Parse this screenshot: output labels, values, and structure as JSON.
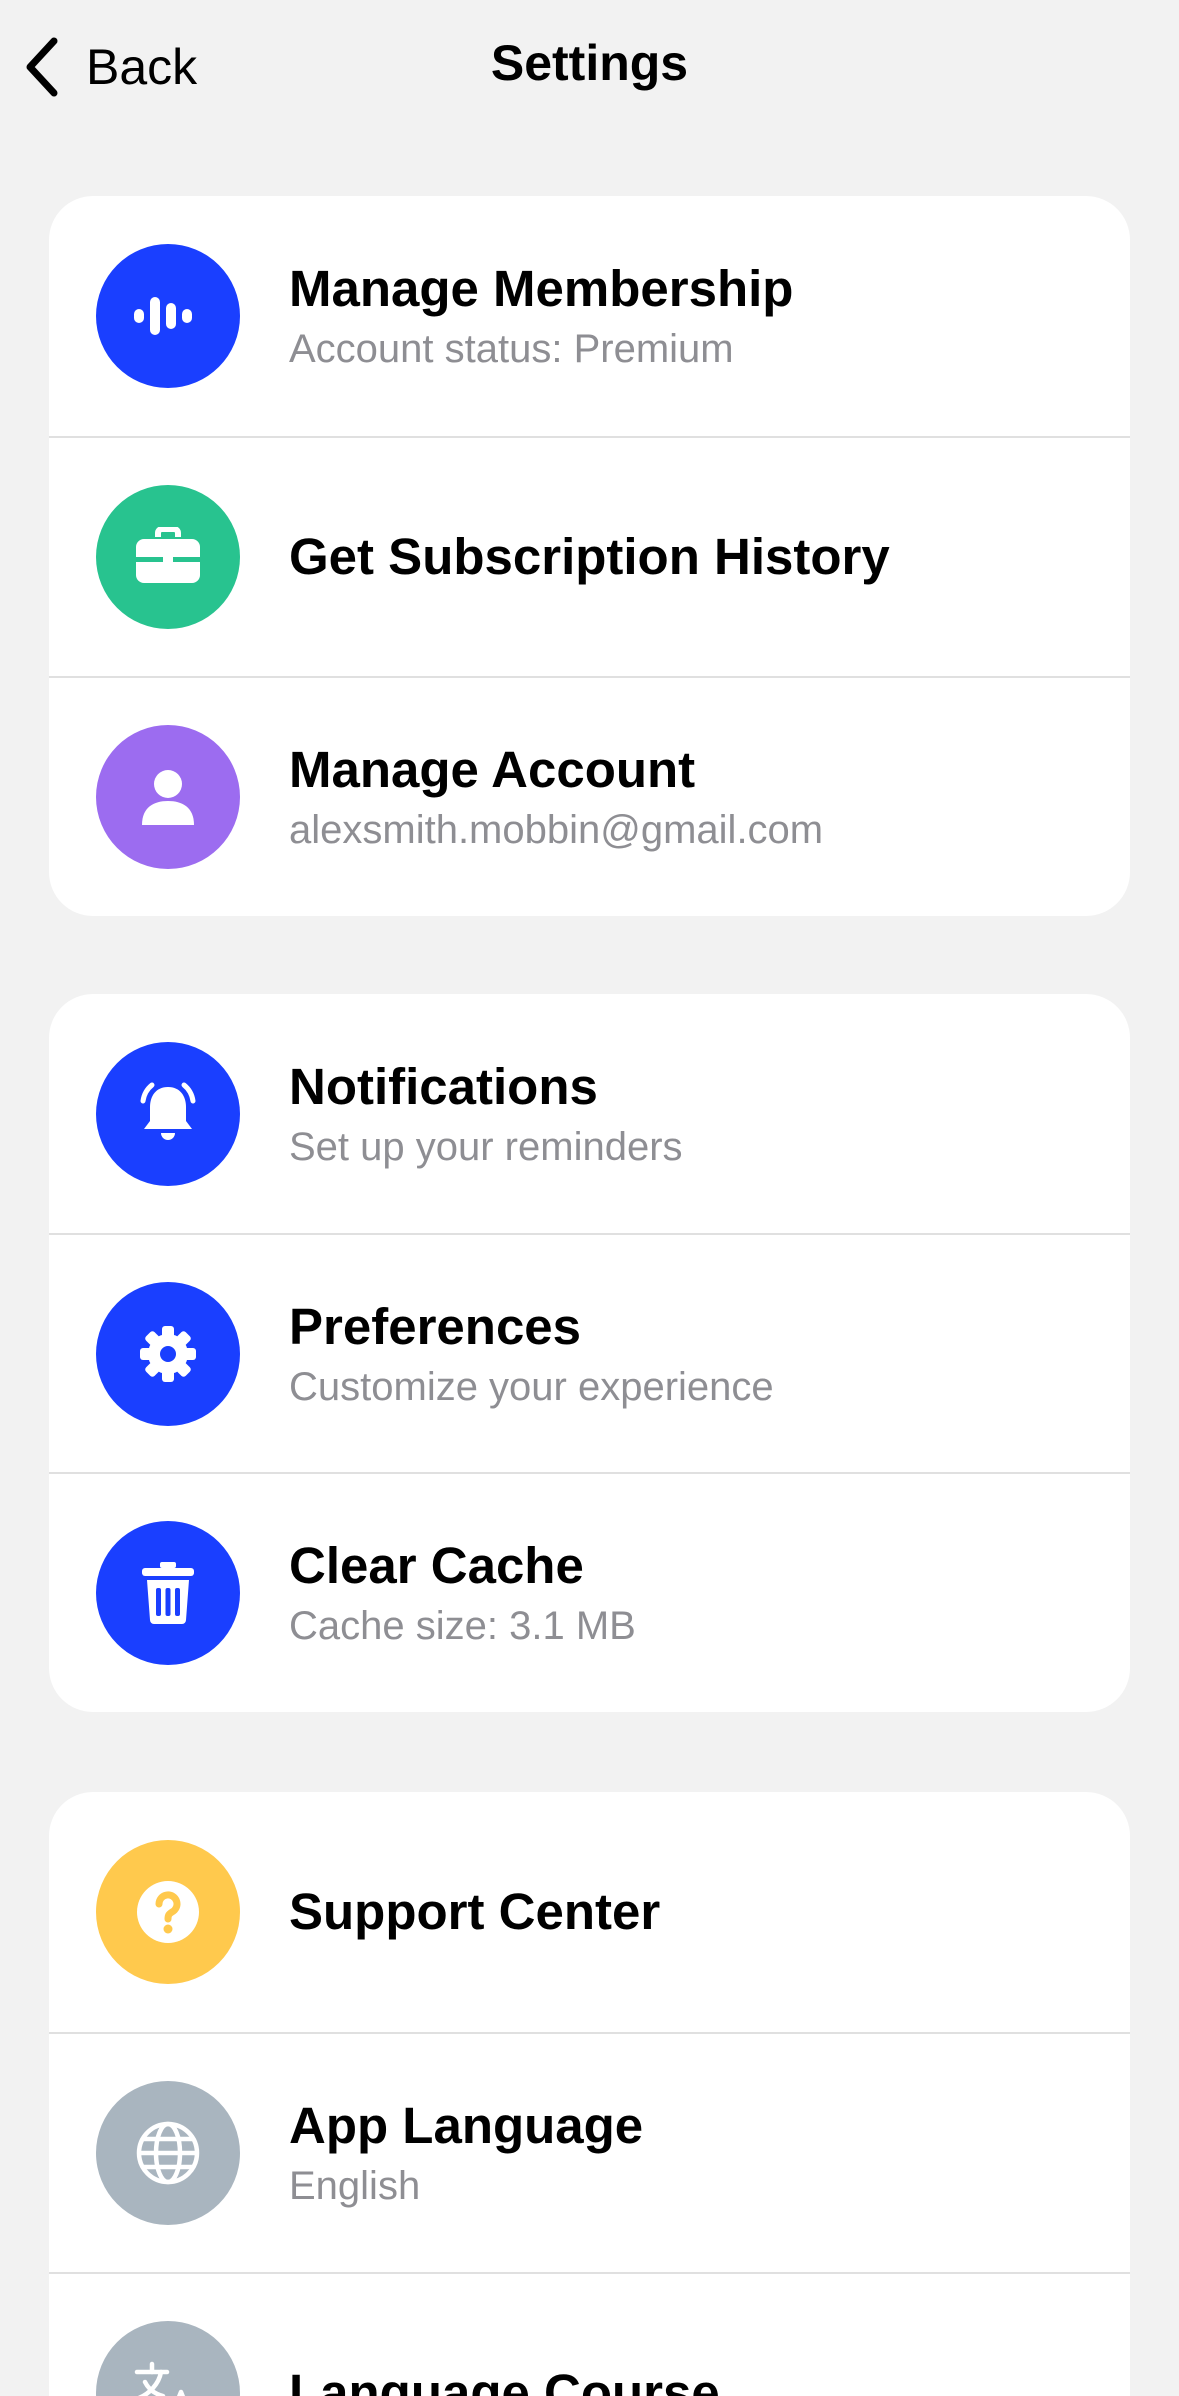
{
  "header": {
    "back_label": "Back",
    "title": "Settings"
  },
  "groups": [
    {
      "items": [
        {
          "icon": "audio-waveform-icon",
          "icon_bg": "#1a3fff",
          "title": "Manage Membership",
          "subtitle": "Account status: Premium"
        },
        {
          "icon": "briefcase-icon",
          "icon_bg": "#28c38f",
          "title": "Get Subscription History",
          "subtitle": ""
        },
        {
          "icon": "person-icon",
          "icon_bg": "#9c6cf0",
          "title": "Manage Account",
          "subtitle": "alexsmith.mobbin@gmail.com"
        }
      ]
    },
    {
      "items": [
        {
          "icon": "bell-icon",
          "icon_bg": "#1a3fff",
          "title": "Notifications",
          "subtitle": "Set up your reminders"
        },
        {
          "icon": "gear-icon",
          "icon_bg": "#1a3fff",
          "title": "Preferences",
          "subtitle": "Customize your experience"
        },
        {
          "icon": "trash-icon",
          "icon_bg": "#1a3fff",
          "title": "Clear Cache",
          "subtitle": "Cache size: 3.1 MB"
        }
      ]
    },
    {
      "items": [
        {
          "icon": "question-mark-icon",
          "icon_bg": "#ffc94d",
          "title": "Support Center",
          "subtitle": ""
        },
        {
          "icon": "globe-icon",
          "icon_bg": "#a9b5bf",
          "title": "App Language",
          "subtitle": "English"
        },
        {
          "icon": "translate-icon",
          "icon_bg": "#a9b5bf",
          "title": "Language Course",
          "subtitle": ""
        }
      ]
    }
  ]
}
